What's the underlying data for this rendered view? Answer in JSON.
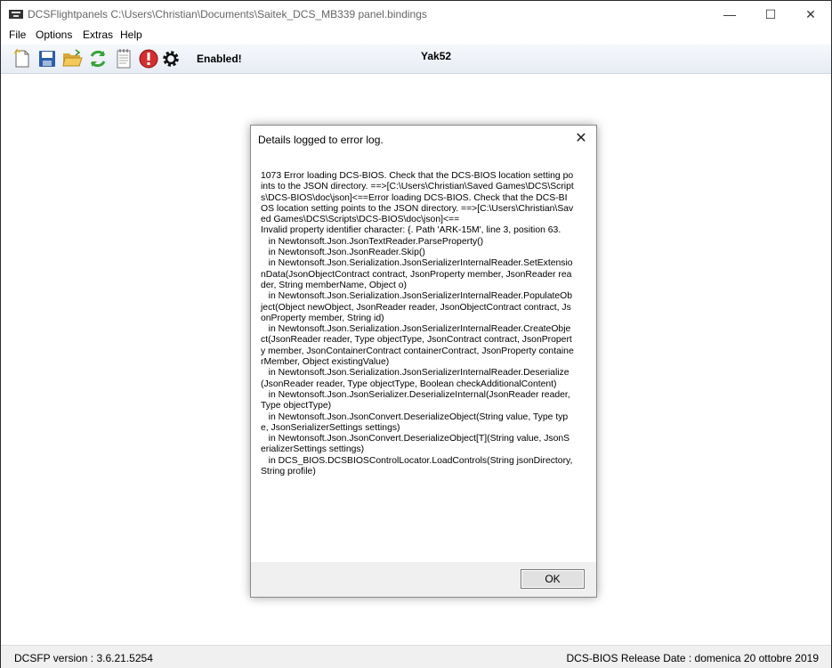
{
  "window": {
    "title": "DCSFlightpanels C:\\Users\\Christian\\Documents\\Saitek_DCS_MB339 panel.bindings",
    "minimize": "—",
    "maximize": "☐",
    "close": "✕"
  },
  "menu": [
    "File",
    "Options",
    "Extras",
    "Help"
  ],
  "toolbar": {
    "icons": [
      "new-file-icon",
      "save-icon",
      "open-folder-icon",
      "refresh-icon",
      "notepad-icon",
      "error-icon",
      "settings-gear-icon"
    ],
    "status": "Enabled!",
    "aircraft": "Yak52"
  },
  "dialog": {
    "title": "Details logged to error log.",
    "close": "✕",
    "message": "1073 Error loading DCS-BIOS. Check that the DCS-BIOS location setting points to the JSON directory. ==>[C:\\Users\\Christian\\Saved Games\\DCS\\Scripts\\DCS-BIOS\\doc\\json]<==Error loading DCS-BIOS. Check that the DCS-BIOS location setting points to the JSON directory. ==>[C:\\Users\\Christian\\Saved Games\\DCS\\Scripts\\DCS-BIOS\\doc\\json]<==\nInvalid property identifier character: {. Path 'ARK-15M', line 3, position 63.\n   in Newtonsoft.Json.JsonTextReader.ParseProperty()\n   in Newtonsoft.Json.JsonReader.Skip()\n   in Newtonsoft.Json.Serialization.JsonSerializerInternalReader.SetExtensionData(JsonObjectContract contract, JsonProperty member, JsonReader reader, String memberName, Object o)\n   in Newtonsoft.Json.Serialization.JsonSerializerInternalReader.PopulateObject(Object newObject, JsonReader reader, JsonObjectContract contract, JsonProperty member, String id)\n   in Newtonsoft.Json.Serialization.JsonSerializerInternalReader.CreateObject(JsonReader reader, Type objectType, JsonContract contract, JsonProperty member, JsonContainerContract containerContract, JsonProperty containerMember, Object existingValue)\n   in Newtonsoft.Json.Serialization.JsonSerializerInternalReader.Deserialize(JsonReader reader, Type objectType, Boolean checkAdditionalContent)\n   in Newtonsoft.Json.JsonSerializer.DeserializeInternal(JsonReader reader, Type objectType)\n   in Newtonsoft.Json.JsonConvert.DeserializeObject(String value, Type type, JsonSerializerSettings settings)\n   in Newtonsoft.Json.JsonConvert.DeserializeObject[T](String value, JsonSerializerSettings settings)\n   in DCS_BIOS.DCSBIOSControlLocator.LoadControls(String jsonDirectory, String profile)",
    "ok": "OK"
  },
  "statusbar": {
    "version": "DCSFP version : 3.6.21.5254",
    "release": "DCS-BIOS Release Date : domenica 20 ottobre 2019"
  }
}
